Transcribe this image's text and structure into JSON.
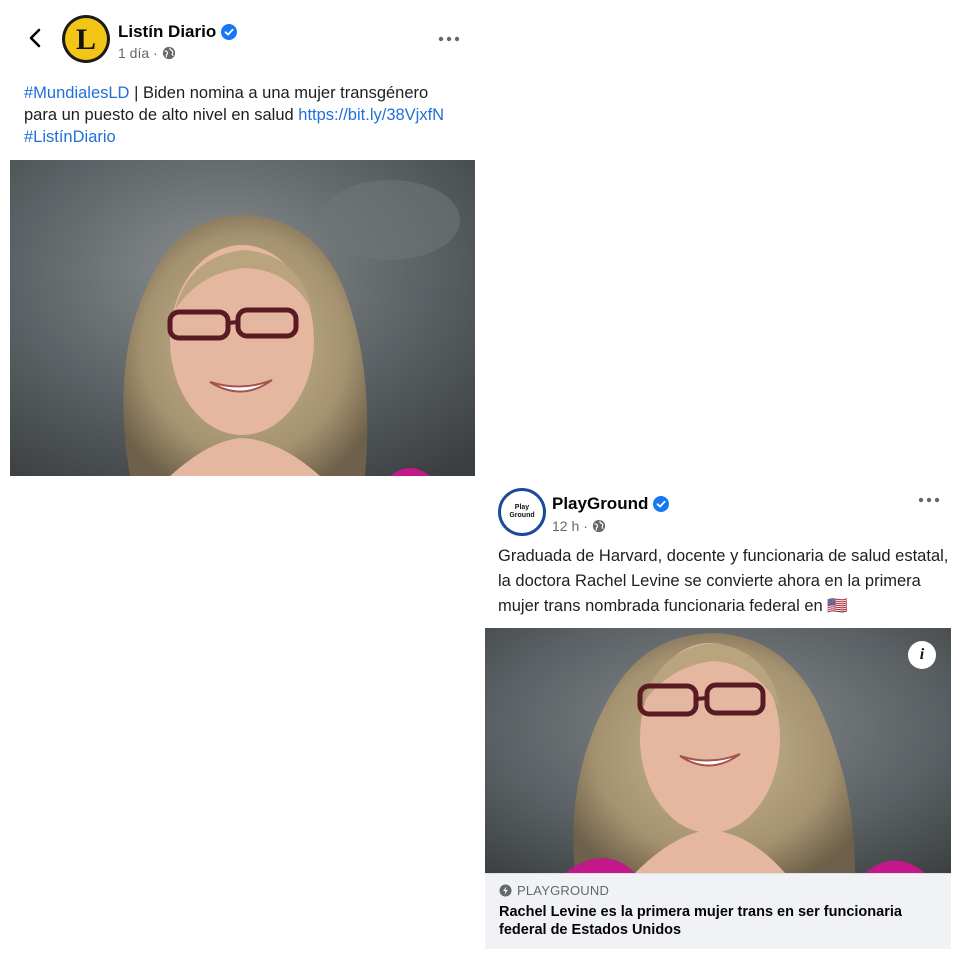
{
  "post_a": {
    "page_name": "Listín Diario",
    "avatar_letter": "L",
    "time": "1 día",
    "separator": "·",
    "text_parts": [
      {
        "text": "#MundialesLD",
        "link": true
      },
      {
        "text": " | Biden nomina a una mujer transgénero para un puesto de alto nivel en salud ",
        "link": false
      },
      {
        "text": "https://bit.ly/38VjxfN",
        "link": true
      },
      {
        "text": " ",
        "link": false
      },
      {
        "text": "#ListínDiario",
        "link": true
      }
    ],
    "icons": {
      "back": "back-arrow-icon",
      "verified": "verified-badge-icon",
      "privacy": "globe-icon",
      "more": "more-options-icon"
    }
  },
  "post_b": {
    "page_name": "PlayGround",
    "avatar_text": "Play\nGround",
    "time": "12 h",
    "separator": "·",
    "text": "Graduada de Harvard, docente y funcionaria de salud estatal, la doctora Rachel Levine se convierte ahora en la primera mujer trans nombrada funcionaria federal en",
    "flag": "🇺🇸",
    "info_label": "i",
    "link_card": {
      "domain": "PLAYGROUND",
      "headline": "Rachel Levine es la primera mujer trans en ser funcionaria federal de Estados Unidos"
    },
    "icons": {
      "verified": "verified-badge-icon",
      "privacy": "globe-icon",
      "more": "more-options-icon",
      "info": "info-icon",
      "domain": "bolt-icon"
    }
  },
  "colors": {
    "link": "#216fdb",
    "verified": "#1877f2",
    "meta_text": "#65676b",
    "card_background": "#f0f2f5",
    "listin_yellow": "#f2c516",
    "playground_ring": "#1a4a9a"
  }
}
